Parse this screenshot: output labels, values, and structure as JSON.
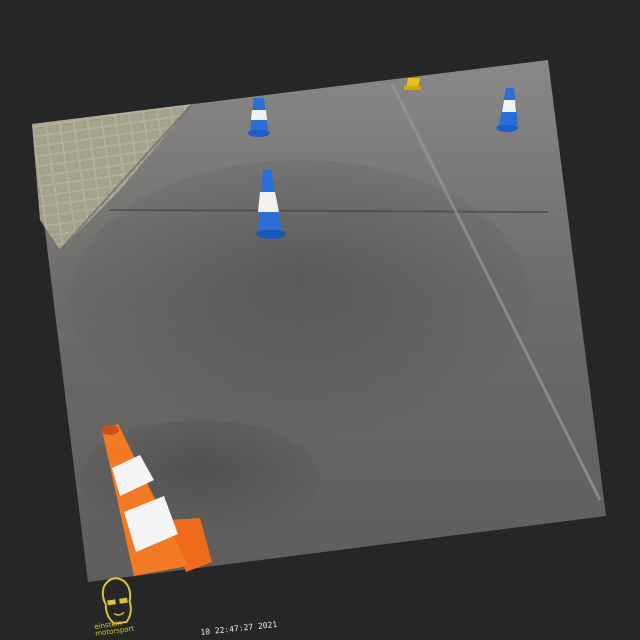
{
  "photo": {
    "description_subject": "traffic cones on concrete pavement",
    "cones": [
      {
        "name": "blue-white-cone-far-left",
        "color": "blue"
      },
      {
        "name": "blue-white-cone-mid",
        "color": "blue"
      },
      {
        "name": "blue-white-cone-far-right",
        "color": "blue"
      },
      {
        "name": "yellow-cone-far",
        "color": "yellow"
      },
      {
        "name": "orange-white-cone-near",
        "color": "orange"
      }
    ]
  },
  "watermark": {
    "logo_icon": "face-with-sunglasses-icon",
    "logo_text_line1": "einstein",
    "logo_text_line2": "motorsport",
    "timestamp": "10 22:47:27 2021"
  },
  "colors": {
    "background": "#262626",
    "pavement": "#6f6d6c",
    "cone_blue": "#1e5fc8",
    "cone_orange": "#f06a1c",
    "logo_yellow": "#d8c23a"
  }
}
